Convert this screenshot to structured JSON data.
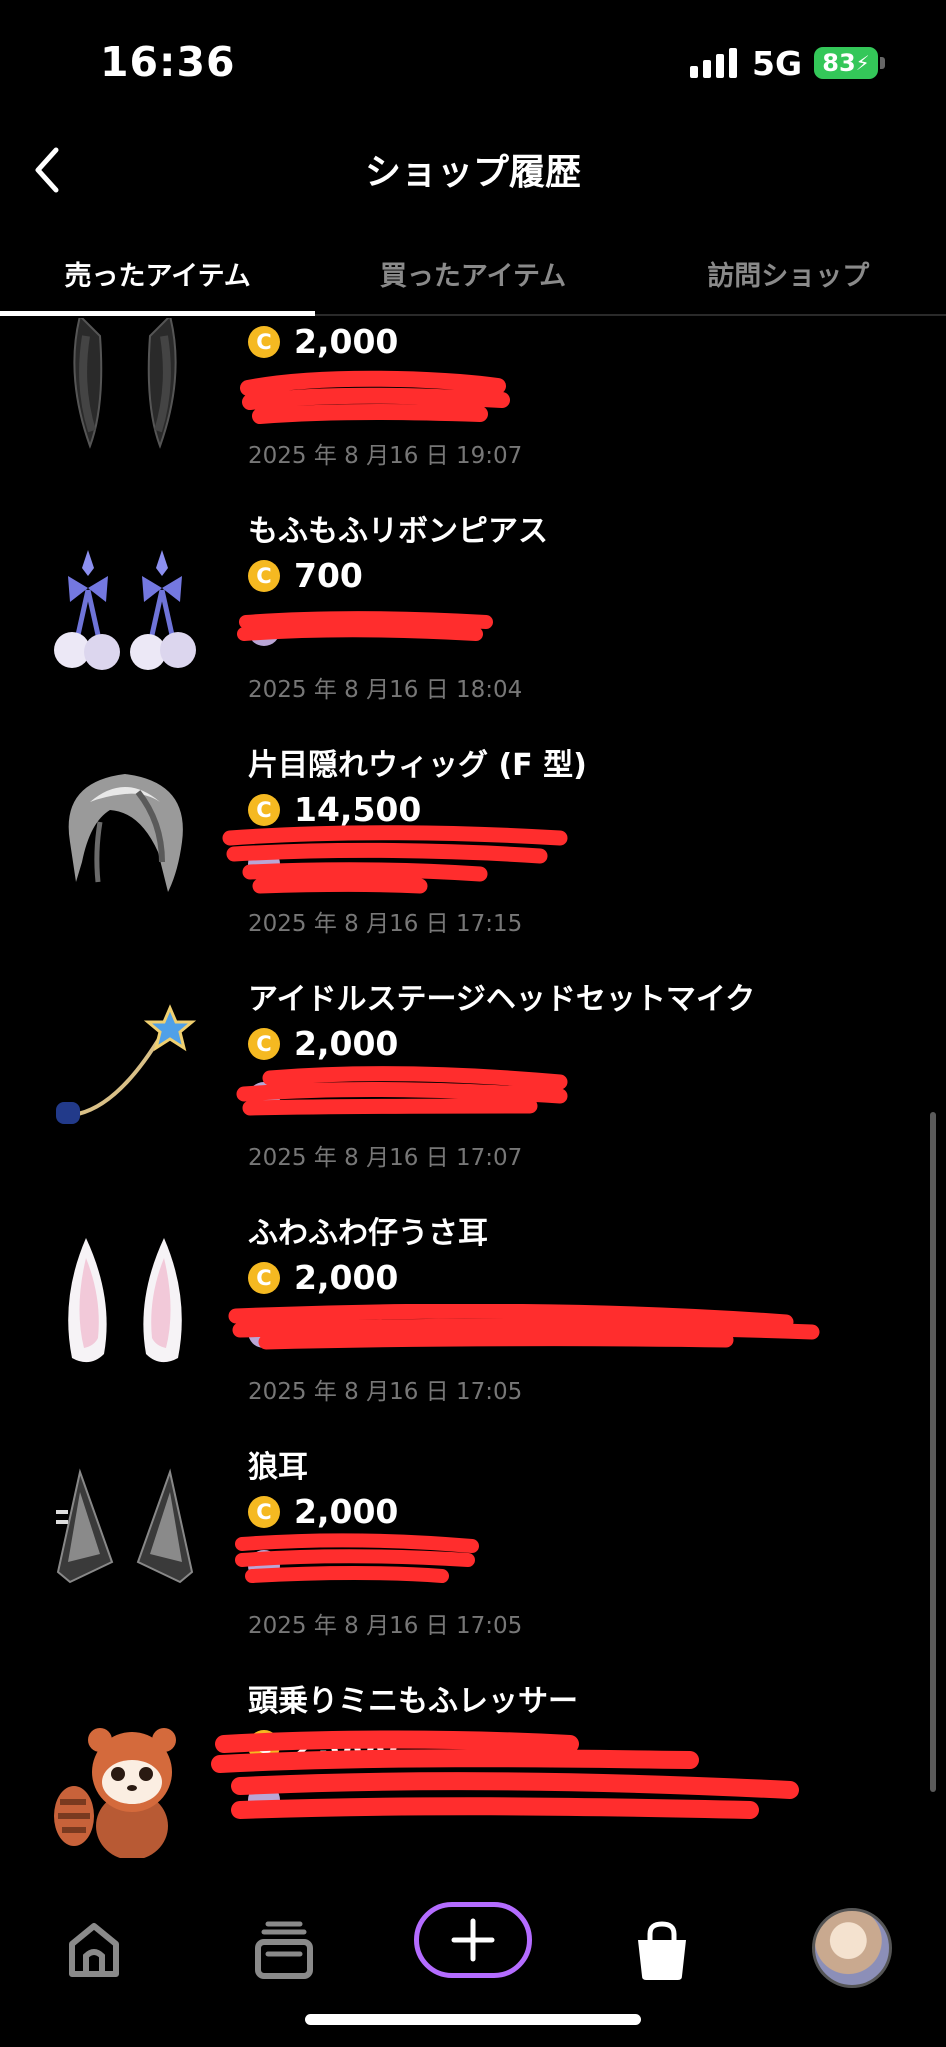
{
  "status_bar": {
    "time": "16:36",
    "network": "5G",
    "battery": "83"
  },
  "nav": {
    "back_icon": "chevron-left-icon",
    "title": "ショップ履歴"
  },
  "tabs": [
    {
      "label": "売ったアイテム",
      "active": true
    },
    {
      "label": "買ったアイテム",
      "active": false
    },
    {
      "label": "訪問ショップ",
      "active": false
    }
  ],
  "coin_symbol": "C",
  "items": [
    {
      "name": "",
      "price": "2,000",
      "date": "2025 年 8 月16 日 19:07",
      "icon": "black-bunny-ears-icon"
    },
    {
      "name": "もふもふリボンピアス",
      "price": "700",
      "date": "2025 年 8 月16 日 18:04",
      "icon": "ribbon-earrings-icon"
    },
    {
      "name": "片目隠れウィッグ (F 型)",
      "price": "14,500",
      "date": "2025 年 8 月16 日 17:15",
      "icon": "silver-wig-icon"
    },
    {
      "name": "アイドルステージヘッドセットマイク",
      "price": "2,000",
      "date": "2025 年 8 月16 日 17:07",
      "icon": "headset-mic-icon"
    },
    {
      "name": "ふわふわ仔うさ耳",
      "price": "2,000",
      "date": "2025 年 8 月16 日 17:05",
      "icon": "white-bunny-ears-icon"
    },
    {
      "name": "狼耳",
      "price": "2,000",
      "date": "2025 年 8 月16 日 17:05",
      "icon": "wolf-ears-icon"
    },
    {
      "name": "頭乗りミニもふレッサー",
      "price": "2,000",
      "date": "",
      "icon": "red-panda-icon"
    }
  ],
  "bottom_nav": [
    "home-icon",
    "catalog-icon",
    "plus-icon",
    "shopping-bag-icon",
    "profile-avatar"
  ],
  "colors": {
    "coin": "#f5b921",
    "redaction": "#ff2d2d",
    "accent_gradient": [
      "#4fb3ff",
      "#b46cff",
      "#ff4fb3"
    ]
  }
}
